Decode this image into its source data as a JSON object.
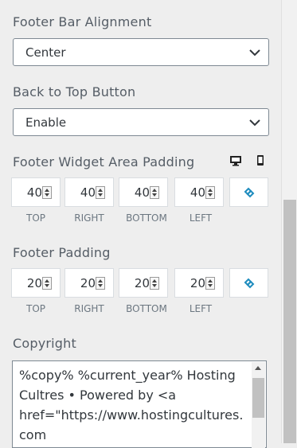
{
  "footer_bar_alignment": {
    "label": "Footer Bar Alignment",
    "value": "Center"
  },
  "back_to_top": {
    "label": "Back to Top Button",
    "value": "Enable"
  },
  "widget_padding": {
    "label": "Footer Widget Area Padding",
    "values": {
      "top": "40",
      "right": "40",
      "bottom": "40",
      "left": "40"
    },
    "sub_labels": {
      "top": "TOP",
      "right": "RIGHT",
      "bottom": "BOTTOM",
      "left": "LEFT"
    }
  },
  "footer_padding": {
    "label": "Footer Padding",
    "values": {
      "top": "20",
      "right": "20",
      "bottom": "20",
      "left": "20"
    },
    "sub_labels": {
      "top": "TOP",
      "right": "RIGHT",
      "bottom": "BOTTOM",
      "left": "LEFT"
    }
  },
  "copyright": {
    "label": "Copyright",
    "value": "%copy% %current_year% Hosting Cultres • Powered by <a href=\"https://www.hostingcultures.com"
  },
  "colors": {
    "link_icon": "#1e8cbe",
    "border": "#7e8993"
  }
}
